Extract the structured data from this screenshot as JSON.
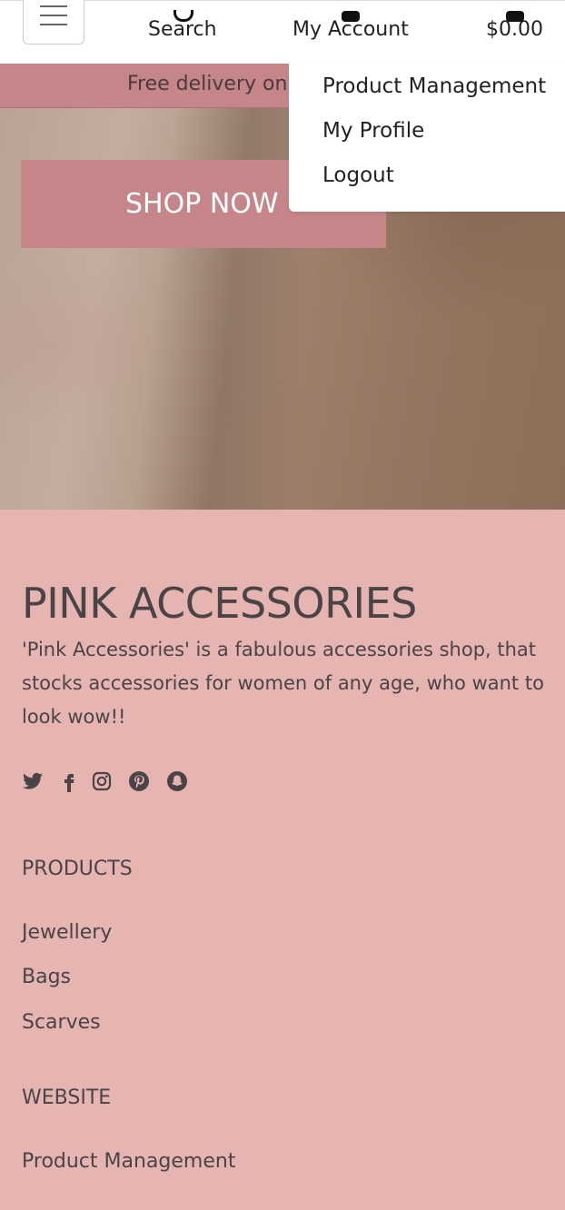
{
  "header": {
    "menu_icon": "hamburger-icon",
    "search": {
      "icon": "search-icon",
      "label": "Search"
    },
    "account": {
      "icon": "user-icon",
      "label": "My Account"
    },
    "cart": {
      "icon": "bag-icon",
      "label": "$0.00"
    }
  },
  "banner": {
    "text": "Free delivery on"
  },
  "account_menu": {
    "items": [
      {
        "label": "Product Management"
      },
      {
        "label": "My Profile"
      },
      {
        "label": "Logout"
      }
    ]
  },
  "hero": {
    "cta_label": "SHOP NOW"
  },
  "footer": {
    "brand": "PINK ACCESSORIES",
    "description": "'Pink Accessories' is a fabulous accessories shop, that stocks accessories for women of any age, who want to look wow!!",
    "social_icons": [
      "twitter-icon",
      "facebook-icon",
      "instagram-icon",
      "pinterest-icon",
      "snapchat-icon"
    ],
    "products_heading": "PRODUCTS",
    "products_links": [
      {
        "label": "Jewellery"
      },
      {
        "label": "Bags"
      },
      {
        "label": "Scarves"
      }
    ],
    "website_heading": "WEBSITE",
    "website_links": [
      {
        "label": "Product Management"
      }
    ]
  },
  "colors": {
    "accent": "#c68689",
    "footer_bg": "#e6b4b1",
    "text": "#4a4446"
  }
}
